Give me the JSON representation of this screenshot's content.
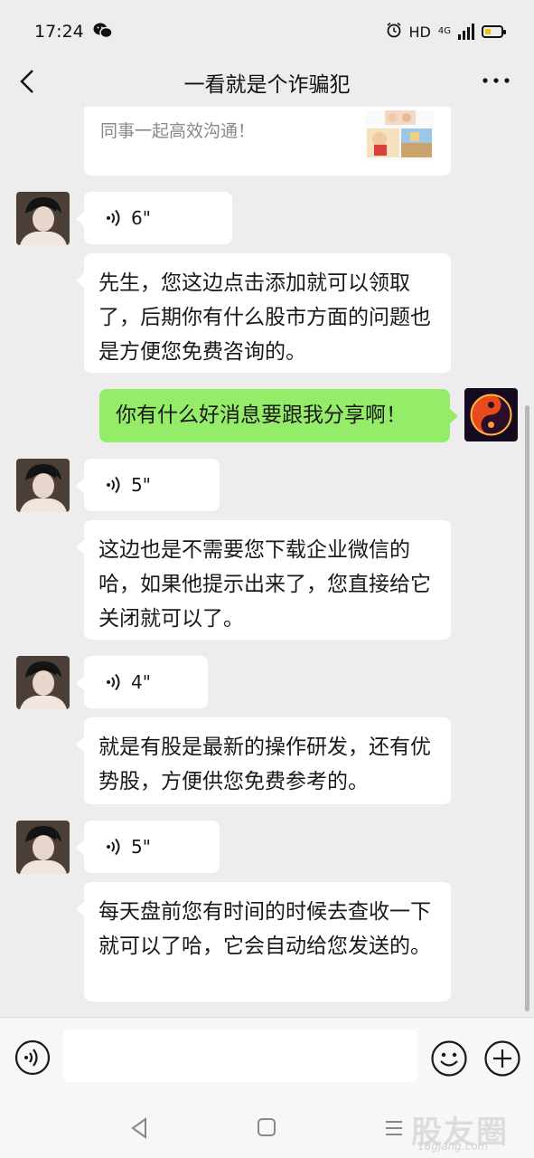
{
  "status_bar": {
    "time": "17:24",
    "wechat_icon": "wechat-logo-icon",
    "alarm_icon": "alarm-clock-icon",
    "hd": "HD",
    "network": "4G",
    "battery_level": 0.4,
    "battery_color": "#f2c200"
  },
  "navbar": {
    "title": "一看就是个诈骗犯",
    "back_icon": "chevron-left-icon",
    "more_icon": "more-dots-icon"
  },
  "messages": {
    "card_text": "同事一起高效沟通！",
    "m1_voice": "6\"",
    "m2_text": "先生，您这边点击添加就可以领取了，后期你有什么股市方面的问题也是方便您免费咨询的。",
    "m3_text": "你有什么好消息要跟我分享啊！",
    "m4_voice": "5\"",
    "m5_text": "这边也是不需要您下载企业微信的哈，如果他提示出来了，您直接给它关闭就可以了。",
    "m6_voice": "4\"",
    "m7_text": "就是有股是最新的操作研发，还有优势股，方便供您免费参考的。",
    "m8_voice": "5\"",
    "m9_text": "每天盘前您有时间的时候去查收一下就可以了哈，它会自动给您发送的。"
  },
  "input_bar": {
    "voice_icon": "voice-input-icon",
    "emoji_icon": "emoji-smile-icon",
    "plus_icon": "plus-circle-icon",
    "value": ""
  },
  "system_nav": {
    "back_icon": "triangle-back-icon",
    "home_icon": "square-home-icon",
    "menu_icon": "lines-menu-icon"
  },
  "watermark": {
    "text": "股友圈",
    "sub": "18gjang.com"
  },
  "colors": {
    "background": "#ededed",
    "sent_bubble": "#95ec69",
    "received_bubble": "#ffffff"
  }
}
